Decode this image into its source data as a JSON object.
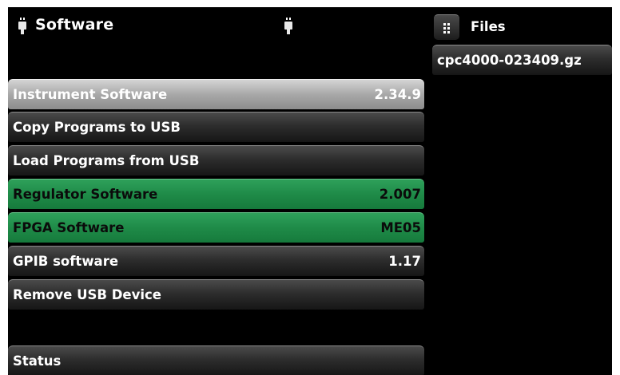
{
  "header": {
    "title": "Software",
    "left_icon": "usb-icon",
    "right_icon": "usb-icon"
  },
  "menu": {
    "items": [
      {
        "label": "Instrument Software",
        "value": "2.34.9",
        "style": "highlighted"
      },
      {
        "label": "Copy Programs to USB",
        "value": "",
        "style": "dark"
      },
      {
        "label": "Load Programs from USB",
        "value": "",
        "style": "dark"
      },
      {
        "label": "Regulator Software",
        "value": "2.007",
        "style": "green"
      },
      {
        "label": "FPGA Software",
        "value": "ME05",
        "style": "green"
      },
      {
        "label": "GPIB software",
        "value": "1.17",
        "style": "dark"
      },
      {
        "label": "Remove USB Device",
        "value": "",
        "style": "dark"
      }
    ],
    "status_label": "Status"
  },
  "files": {
    "title": "Files",
    "icon": "grid-menu-icon",
    "items": [
      "cpc4000-023409.gz"
    ]
  },
  "colors": {
    "background": "#000000",
    "green": "#1f8b48",
    "highlight": "#a8a8a8"
  }
}
